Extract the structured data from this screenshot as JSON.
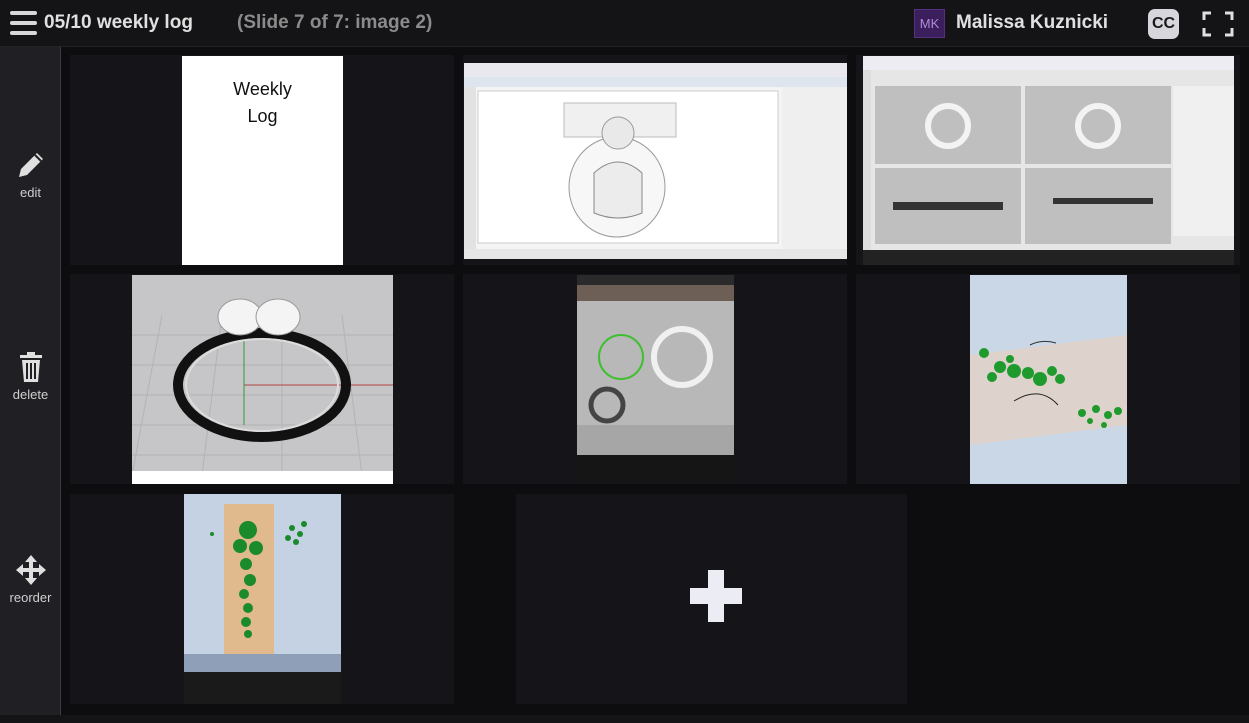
{
  "header": {
    "title": "05/10 weekly log",
    "slide_info": "(Slide 7 of 7: image 2)",
    "user_initials": "MK",
    "user_name": "Malissa Kuznicki",
    "cc_label": "CC"
  },
  "sidebar": {
    "items": [
      {
        "label": "edit",
        "icon": "pencil-icon"
      },
      {
        "label": "delete",
        "icon": "trash-icon"
      },
      {
        "label": "reorder",
        "icon": "move-arrows-icon"
      }
    ]
  },
  "slides": {
    "cover_text_line1": "Weekly",
    "cover_text_line2": "Log"
  },
  "colors": {
    "background": "#0d0d0f",
    "sidebar": "#202024",
    "tile": "#151519",
    "avatar_bg": "#3a1f5c"
  }
}
